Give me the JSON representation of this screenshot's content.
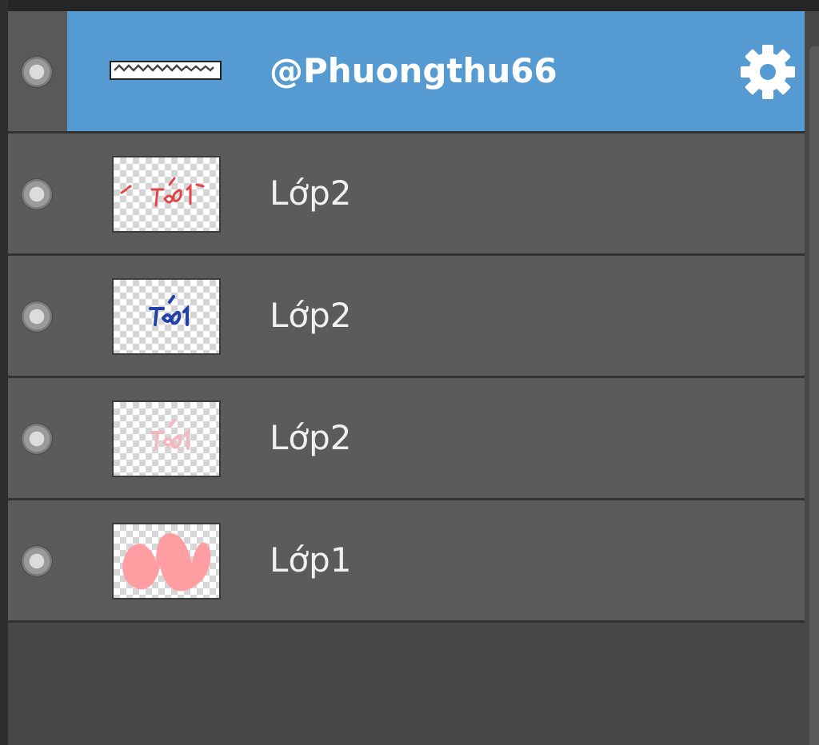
{
  "layers": [
    {
      "name": "@Phuongthu66",
      "type": "text",
      "selected": true,
      "thumb_icon": "text-layer-thumbnail"
    },
    {
      "name": "Lớp2",
      "type": "raster",
      "selected": false,
      "thumb_icon": "red-handwriting-thumbnail"
    },
    {
      "name": "Lớp2",
      "type": "raster",
      "selected": false,
      "thumb_icon": "blue-handwriting-thumbnail"
    },
    {
      "name": "Lớp2",
      "type": "raster",
      "selected": false,
      "thumb_icon": "faint-pink-handwriting-thumbnail"
    },
    {
      "name": "Lớp1",
      "type": "raster",
      "selected": false,
      "thumb_icon": "pink-brush-thumbnail"
    }
  ],
  "colors": {
    "selected_row": "#559bd1",
    "row": "#5b5b5b",
    "panel": "#474747",
    "red_ink": "#e0454a",
    "blue_ink": "#2142a8",
    "pink_ink": "#f2b9bf",
    "brush_pink": "#ff9ea2"
  },
  "icons": {
    "visibility": "visibility-dot-icon",
    "settings": "gear-icon"
  }
}
